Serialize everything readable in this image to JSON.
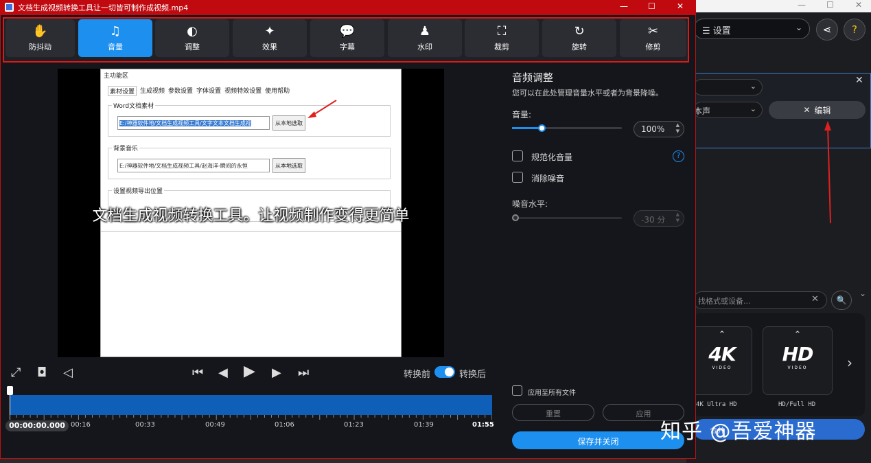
{
  "window": {
    "title": "文档生成视频转换工具让一切皆可制作成视频.mp4",
    "accent": "#c00a10"
  },
  "toolbar": {
    "items": [
      {
        "label": "防抖动",
        "icon": "hand-icon",
        "glyph": "✋"
      },
      {
        "label": "音量",
        "icon": "music-note-icon",
        "glyph": "♫"
      },
      {
        "label": "调整",
        "icon": "contrast-icon",
        "glyph": "◐"
      },
      {
        "label": "效果",
        "icon": "magic-wand-icon",
        "glyph": "✦"
      },
      {
        "label": "字幕",
        "icon": "speech-bubble-icon",
        "glyph": "💬"
      },
      {
        "label": "水印",
        "icon": "stamp-icon",
        "glyph": "♟"
      },
      {
        "label": "裁剪",
        "icon": "crop-icon",
        "glyph": "⛶"
      },
      {
        "label": "旋转",
        "icon": "rotate-icon",
        "glyph": "↻"
      },
      {
        "label": "修剪",
        "icon": "scissors-icon",
        "glyph": "✂"
      }
    ],
    "active_index": 1,
    "active_color": "#1d8fef"
  },
  "video": {
    "subtitle": "文档生成视频转换工具。让视频制作变得更简单",
    "screen": {
      "header": "主功能区",
      "tabs": [
        "素材设置",
        "生成视频",
        "参数设置",
        "字体设置",
        "视频特效设置",
        "使用帮助"
      ],
      "group1_title": "Word文档素材",
      "group1_path": "E:/神器软件地/文档生成视频工具/文字文本文档生成视",
      "group1_button": "从本地选取",
      "group2_title": "背景音乐",
      "group2_path": "E:/神器软件地/文档生成视频工具/赵海洋-瞬间的永恒",
      "group2_button": "从本地选取",
      "group3_title": "设置视频导出位置"
    }
  },
  "controls": {
    "before_label": "转换前",
    "after_label": "转换后",
    "toggle_on": true
  },
  "timeline": {
    "timecode": "00:00:00.000",
    "ticks": [
      "00:16",
      "00:33",
      "00:49",
      "01:06",
      "01:23",
      "01:39",
      "01:55"
    ],
    "color": "#0f5fb8"
  },
  "audio": {
    "title": "音频调整",
    "desc": "您可以在此处管理音量水平或者为背景降噪。",
    "volume_label": "音量:",
    "volume_value": "100%",
    "volume_fraction": 0.27,
    "normalize_label": "规范化音量",
    "denoise_label": "消除噪音",
    "noise_level_label": "噪音水平:",
    "noise_value": "-30 分",
    "apply_all_label": "应用至所有文件",
    "reset_label": "重置",
    "apply_label": "应用",
    "save_label": "保存并关闭"
  },
  "background_app": {
    "settings_label": "设置",
    "dropdown2": "本声",
    "edit_label": "编辑",
    "search_placeholder": "找格式或设备...",
    "formats": [
      {
        "logo": "4K",
        "sub": "VIDEO",
        "label": "4K Ultra HD"
      },
      {
        "logo": "HD",
        "sub": "VIDEO",
        "label": "HD/Full HD"
      }
    ],
    "merge_label": "合并"
  },
  "watermark": "知乎 @吾爱神器"
}
